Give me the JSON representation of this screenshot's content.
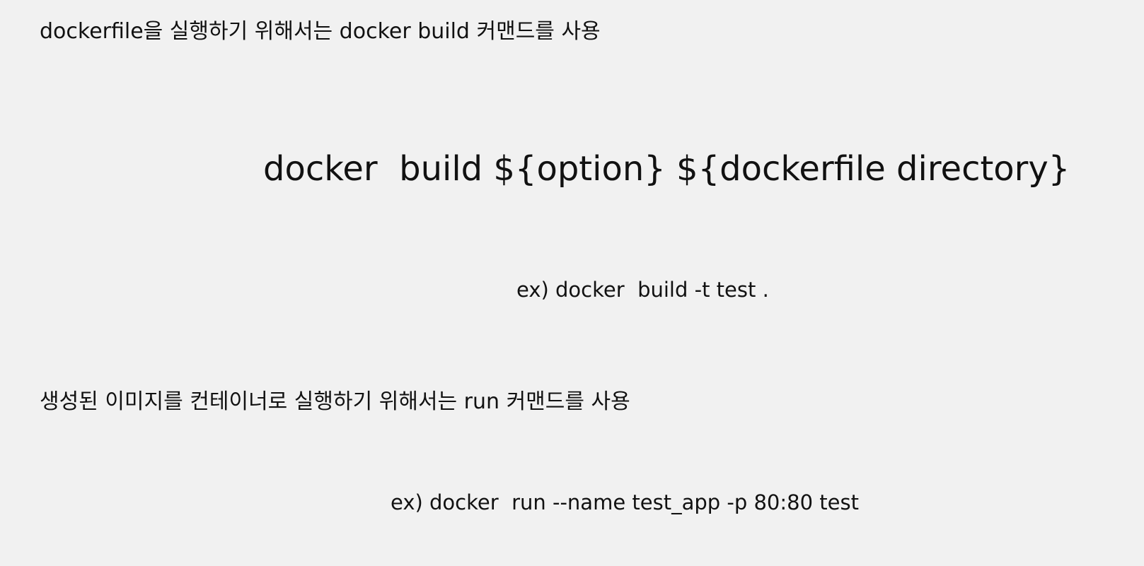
{
  "slide": {
    "intro_build": "dockerfile을 실행하기 위해서는 docker build 커맨드를 사용",
    "build_syntax": "docker  build ${option} ${dockerfile directory}",
    "build_example": "ex) docker  build -t test .",
    "intro_run": "생성된 이미지를 컨테이너로 실행하기 위해서는 run 커맨드를 사용",
    "run_example": "ex) docker  run --name test_app -p 80:80 test"
  },
  "colors": {
    "background": "#f1f1f1",
    "text": "#111111"
  }
}
